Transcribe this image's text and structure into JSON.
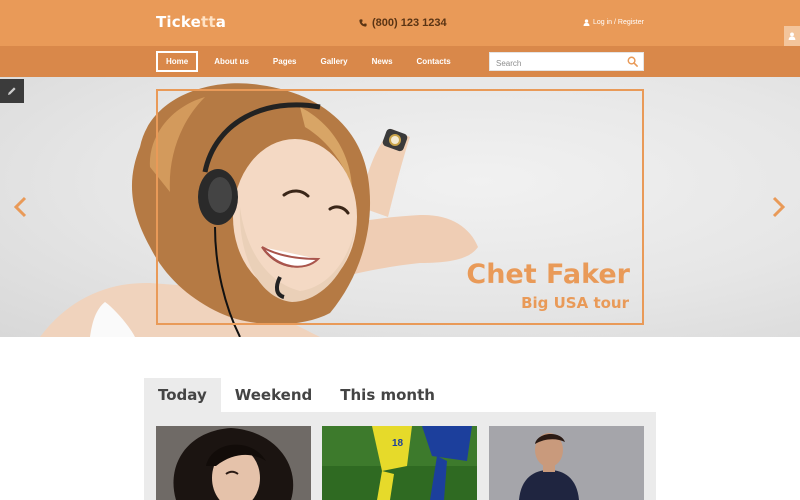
{
  "header": {
    "logo": {
      "part1": "Ticke",
      "part2": "tt",
      "part3": "a"
    },
    "phone": "(800) 123 1234",
    "auth": "Log in / Register"
  },
  "nav": {
    "items": [
      {
        "label": "Home",
        "active": true
      },
      {
        "label": "About us",
        "active": false
      },
      {
        "label": "Pages",
        "active": false
      },
      {
        "label": "Gallery",
        "active": false
      },
      {
        "label": "News",
        "active": false
      },
      {
        "label": "Contacts",
        "active": false
      }
    ],
    "search_placeholder": "Search"
  },
  "hero": {
    "title": "Chet Faker",
    "subtitle": "Big USA tour"
  },
  "tabs": [
    {
      "label": "Today",
      "active": true
    },
    {
      "label": "Weekend",
      "active": false
    },
    {
      "label": "This month",
      "active": false
    }
  ],
  "icons": {
    "phone": "phone-icon",
    "user": "user-icon",
    "search": "search-icon",
    "edit": "pencil-icon",
    "prev": "chevron-left-icon",
    "next": "chevron-right-icon"
  },
  "colors": {
    "accent": "#e99a58",
    "nav": "#d9884a",
    "dark": "#3b3b3b"
  }
}
